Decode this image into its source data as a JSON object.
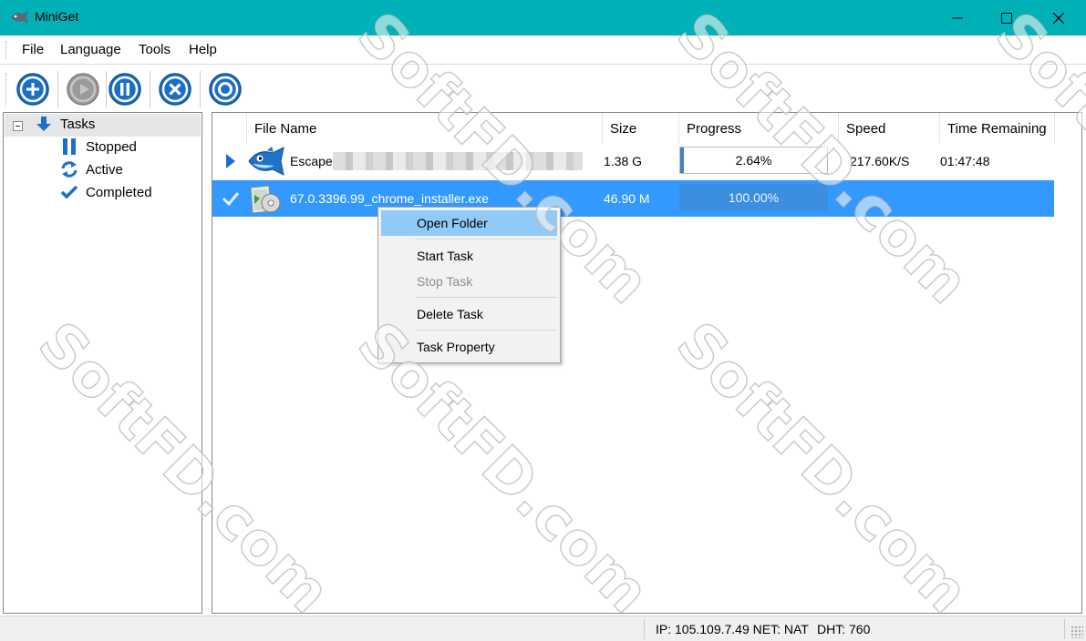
{
  "window": {
    "title": "MiniGet",
    "icon": "fish-icon"
  },
  "menubar": {
    "items": [
      "File",
      "Language",
      "Tools",
      "Help"
    ]
  },
  "toolbar": {
    "buttons": [
      "add-icon",
      "start-icon",
      "pause-icon",
      "delete-icon",
      "settings-icon"
    ]
  },
  "tree": {
    "root": "Tasks",
    "children": [
      "Stopped",
      "Active",
      "Completed"
    ]
  },
  "list": {
    "columns": [
      "File Name",
      "Size",
      "Progress",
      "Speed",
      "Time Remaining"
    ],
    "rows": [
      {
        "name": "Escape",
        "size": "1.38 G",
        "progress_text": "2.64%",
        "progress": 0.0264,
        "speed": "217.60K/S",
        "time_remaining": "01:47:48",
        "status": "active"
      },
      {
        "name": "67.0.3396.99_chrome_installer.exe",
        "size": "46.90 M",
        "progress_text": "100.00%",
        "progress": 1.0,
        "speed": "",
        "time_remaining": "",
        "status": "completed"
      }
    ]
  },
  "context_menu": {
    "items": [
      {
        "label": "Open Folder",
        "state": "highlighted"
      },
      {
        "label": "Start Task",
        "state": "enabled"
      },
      {
        "label": "Stop Task",
        "state": "disabled"
      },
      {
        "label": "Delete Task",
        "state": "enabled"
      },
      {
        "label": "Task Property",
        "state": "enabled"
      }
    ]
  },
  "statusbar": {
    "network": "IP: 105.109.7.49 NET: NAT",
    "dht": "DHT: 760"
  },
  "watermark": "SoftFD.com",
  "colors": {
    "titlebar": "#00b2b8",
    "selection": "#3399ff",
    "toolbar_icon": "#1c6fc9",
    "menu_highlight": "#91c9f7"
  }
}
